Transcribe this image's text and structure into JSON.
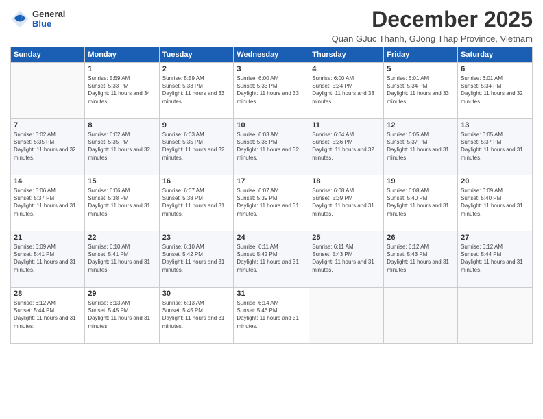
{
  "logo": {
    "general": "General",
    "blue": "Blue"
  },
  "title": "December 2025",
  "subtitle": "Quan GJuc Thanh, GJong Thap Province, Vietnam",
  "weekdays": [
    "Sunday",
    "Monday",
    "Tuesday",
    "Wednesday",
    "Thursday",
    "Friday",
    "Saturday"
  ],
  "weeks": [
    [
      {
        "day": "",
        "sunrise": "",
        "sunset": "",
        "daylight": ""
      },
      {
        "day": "1",
        "sunrise": "Sunrise: 5:59 AM",
        "sunset": "Sunset: 5:33 PM",
        "daylight": "Daylight: 11 hours and 34 minutes."
      },
      {
        "day": "2",
        "sunrise": "Sunrise: 5:59 AM",
        "sunset": "Sunset: 5:33 PM",
        "daylight": "Daylight: 11 hours and 33 minutes."
      },
      {
        "day": "3",
        "sunrise": "Sunrise: 6:00 AM",
        "sunset": "Sunset: 5:33 PM",
        "daylight": "Daylight: 11 hours and 33 minutes."
      },
      {
        "day": "4",
        "sunrise": "Sunrise: 6:00 AM",
        "sunset": "Sunset: 5:34 PM",
        "daylight": "Daylight: 11 hours and 33 minutes."
      },
      {
        "day": "5",
        "sunrise": "Sunrise: 6:01 AM",
        "sunset": "Sunset: 5:34 PM",
        "daylight": "Daylight: 11 hours and 33 minutes."
      },
      {
        "day": "6",
        "sunrise": "Sunrise: 6:01 AM",
        "sunset": "Sunset: 5:34 PM",
        "daylight": "Daylight: 11 hours and 32 minutes."
      }
    ],
    [
      {
        "day": "7",
        "sunrise": "Sunrise: 6:02 AM",
        "sunset": "Sunset: 5:35 PM",
        "daylight": "Daylight: 11 hours and 32 minutes."
      },
      {
        "day": "8",
        "sunrise": "Sunrise: 6:02 AM",
        "sunset": "Sunset: 5:35 PM",
        "daylight": "Daylight: 11 hours and 32 minutes."
      },
      {
        "day": "9",
        "sunrise": "Sunrise: 6:03 AM",
        "sunset": "Sunset: 5:35 PM",
        "daylight": "Daylight: 11 hours and 32 minutes."
      },
      {
        "day": "10",
        "sunrise": "Sunrise: 6:03 AM",
        "sunset": "Sunset: 5:36 PM",
        "daylight": "Daylight: 11 hours and 32 minutes."
      },
      {
        "day": "11",
        "sunrise": "Sunrise: 6:04 AM",
        "sunset": "Sunset: 5:36 PM",
        "daylight": "Daylight: 11 hours and 32 minutes."
      },
      {
        "day": "12",
        "sunrise": "Sunrise: 6:05 AM",
        "sunset": "Sunset: 5:37 PM",
        "daylight": "Daylight: 11 hours and 31 minutes."
      },
      {
        "day": "13",
        "sunrise": "Sunrise: 6:05 AM",
        "sunset": "Sunset: 5:37 PM",
        "daylight": "Daylight: 11 hours and 31 minutes."
      }
    ],
    [
      {
        "day": "14",
        "sunrise": "Sunrise: 6:06 AM",
        "sunset": "Sunset: 5:37 PM",
        "daylight": "Daylight: 11 hours and 31 minutes."
      },
      {
        "day": "15",
        "sunrise": "Sunrise: 6:06 AM",
        "sunset": "Sunset: 5:38 PM",
        "daylight": "Daylight: 11 hours and 31 minutes."
      },
      {
        "day": "16",
        "sunrise": "Sunrise: 6:07 AM",
        "sunset": "Sunset: 5:38 PM",
        "daylight": "Daylight: 11 hours and 31 minutes."
      },
      {
        "day": "17",
        "sunrise": "Sunrise: 6:07 AM",
        "sunset": "Sunset: 5:39 PM",
        "daylight": "Daylight: 11 hours and 31 minutes."
      },
      {
        "day": "18",
        "sunrise": "Sunrise: 6:08 AM",
        "sunset": "Sunset: 5:39 PM",
        "daylight": "Daylight: 11 hours and 31 minutes."
      },
      {
        "day": "19",
        "sunrise": "Sunrise: 6:08 AM",
        "sunset": "Sunset: 5:40 PM",
        "daylight": "Daylight: 11 hours and 31 minutes."
      },
      {
        "day": "20",
        "sunrise": "Sunrise: 6:09 AM",
        "sunset": "Sunset: 5:40 PM",
        "daylight": "Daylight: 11 hours and 31 minutes."
      }
    ],
    [
      {
        "day": "21",
        "sunrise": "Sunrise: 6:09 AM",
        "sunset": "Sunset: 5:41 PM",
        "daylight": "Daylight: 11 hours and 31 minutes."
      },
      {
        "day": "22",
        "sunrise": "Sunrise: 6:10 AM",
        "sunset": "Sunset: 5:41 PM",
        "daylight": "Daylight: 11 hours and 31 minutes."
      },
      {
        "day": "23",
        "sunrise": "Sunrise: 6:10 AM",
        "sunset": "Sunset: 5:42 PM",
        "daylight": "Daylight: 11 hours and 31 minutes."
      },
      {
        "day": "24",
        "sunrise": "Sunrise: 6:11 AM",
        "sunset": "Sunset: 5:42 PM",
        "daylight": "Daylight: 11 hours and 31 minutes."
      },
      {
        "day": "25",
        "sunrise": "Sunrise: 6:11 AM",
        "sunset": "Sunset: 5:43 PM",
        "daylight": "Daylight: 11 hours and 31 minutes."
      },
      {
        "day": "26",
        "sunrise": "Sunrise: 6:12 AM",
        "sunset": "Sunset: 5:43 PM",
        "daylight": "Daylight: 11 hours and 31 minutes."
      },
      {
        "day": "27",
        "sunrise": "Sunrise: 6:12 AM",
        "sunset": "Sunset: 5:44 PM",
        "daylight": "Daylight: 11 hours and 31 minutes."
      }
    ],
    [
      {
        "day": "28",
        "sunrise": "Sunrise: 6:12 AM",
        "sunset": "Sunset: 5:44 PM",
        "daylight": "Daylight: 11 hours and 31 minutes."
      },
      {
        "day": "29",
        "sunrise": "Sunrise: 6:13 AM",
        "sunset": "Sunset: 5:45 PM",
        "daylight": "Daylight: 11 hours and 31 minutes."
      },
      {
        "day": "30",
        "sunrise": "Sunrise: 6:13 AM",
        "sunset": "Sunset: 5:45 PM",
        "daylight": "Daylight: 11 hours and 31 minutes."
      },
      {
        "day": "31",
        "sunrise": "Sunrise: 6:14 AM",
        "sunset": "Sunset: 5:46 PM",
        "daylight": "Daylight: 11 hours and 31 minutes."
      },
      {
        "day": "",
        "sunrise": "",
        "sunset": "",
        "daylight": ""
      },
      {
        "day": "",
        "sunrise": "",
        "sunset": "",
        "daylight": ""
      },
      {
        "day": "",
        "sunrise": "",
        "sunset": "",
        "daylight": ""
      }
    ]
  ]
}
